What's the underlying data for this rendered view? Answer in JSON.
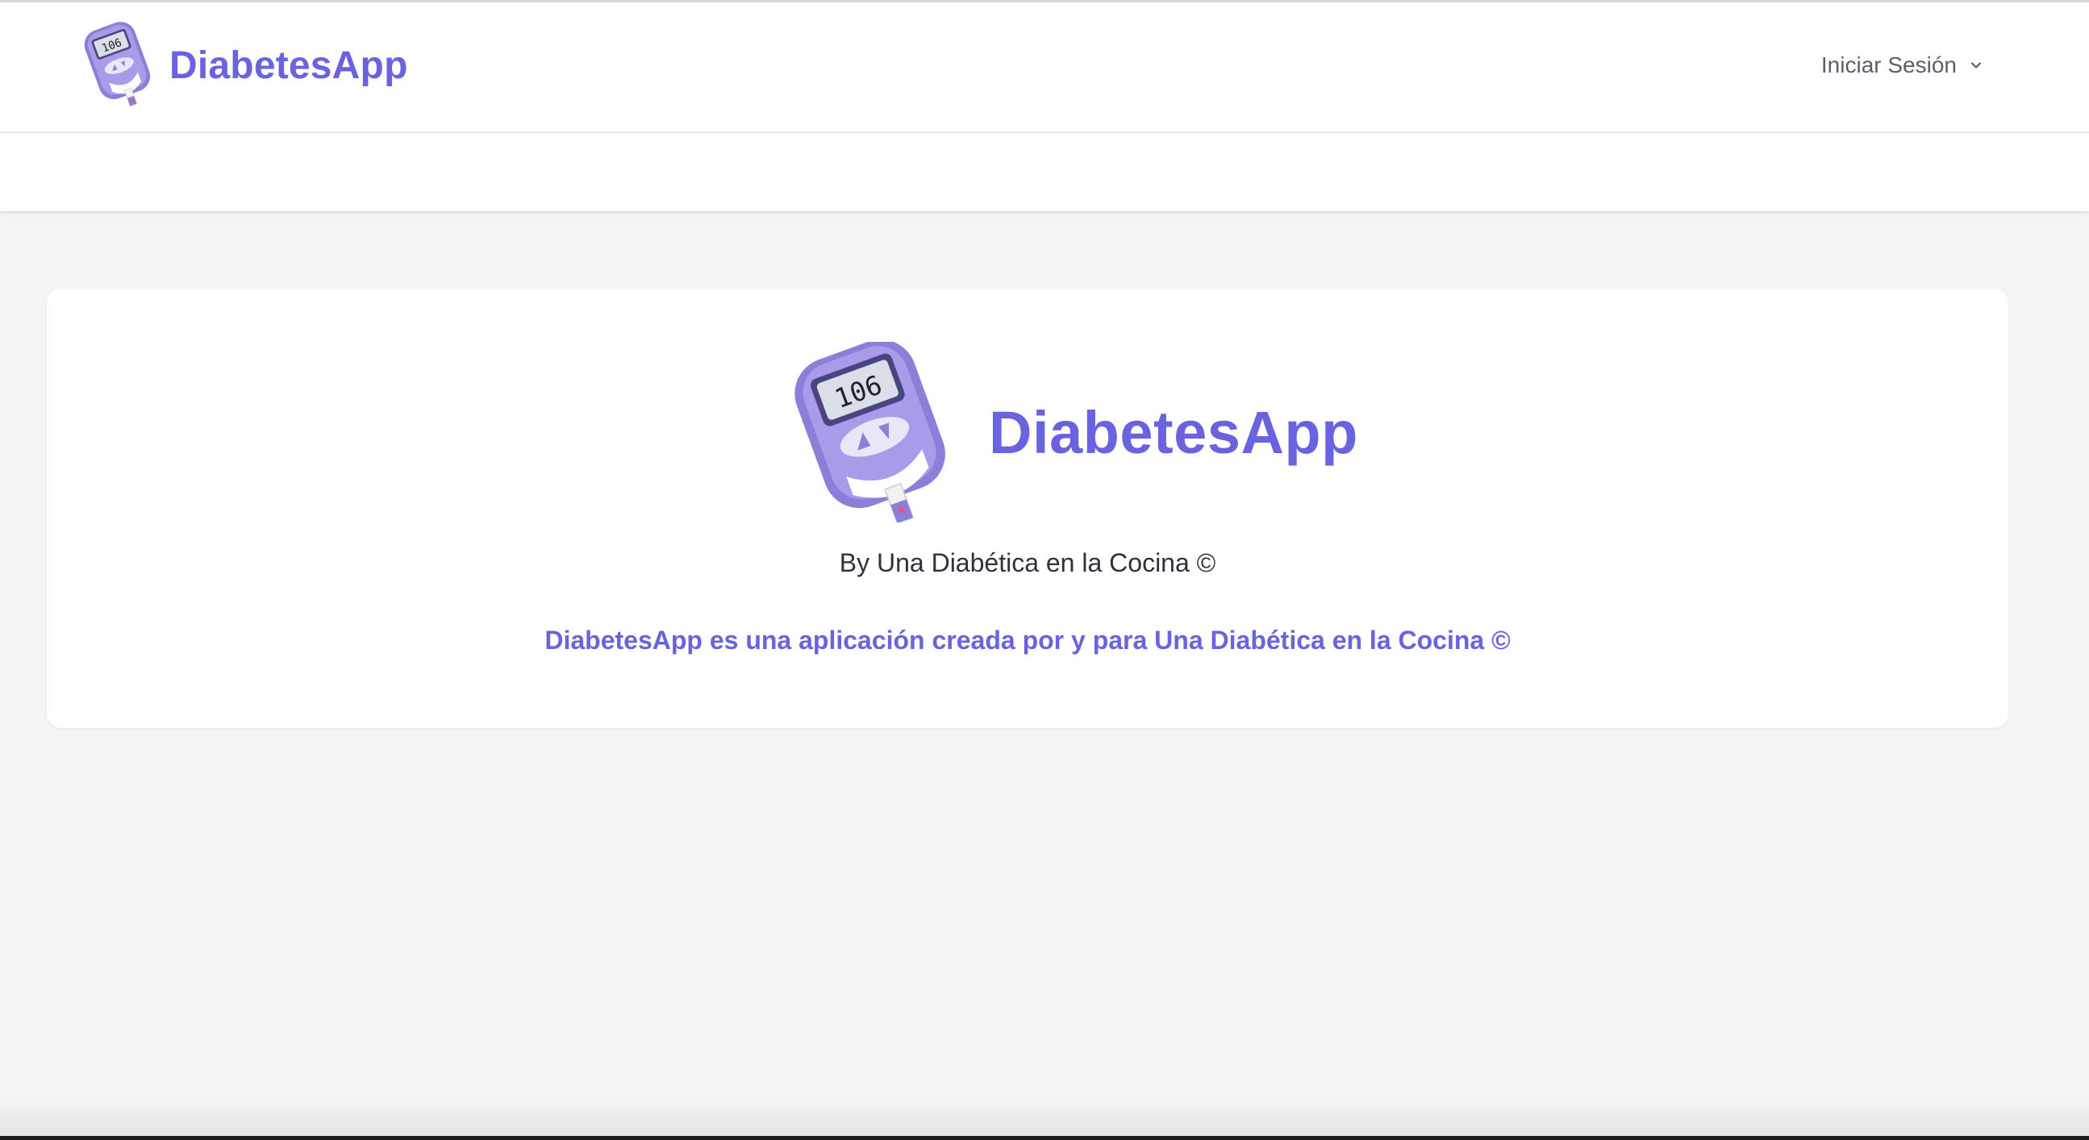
{
  "navbar": {
    "brand_name": "DiabetesApp",
    "logo_icon": "glucose-meter-icon",
    "user_menu_label": "Iniciar Sesión",
    "user_menu_icon": "chevron-down-icon"
  },
  "card": {
    "title": "DiabetesApp",
    "logo_icon": "glucose-meter-icon",
    "meter_reading": "106",
    "byline": "By Una Diabética en la Cocina ©",
    "description": "DiabetesApp es una aplicación creada por y para Una Diabética en la Cocina ©"
  },
  "colors": {
    "accent": "#6a63e0",
    "page_background": "#f3f4f6",
    "card_background": "#ffffff",
    "text": "#2f323a",
    "muted_text": "#5b5f6a"
  }
}
